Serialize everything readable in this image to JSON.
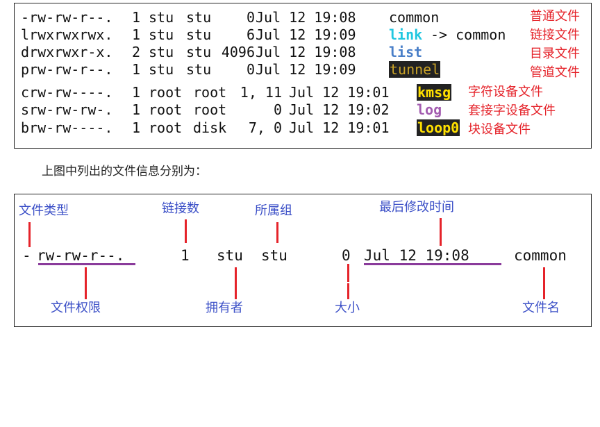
{
  "terminal": {
    "rows": [
      {
        "perm": "-rw-rw-r--.",
        "links": "1",
        "owner": "stu",
        "group": "stu",
        "size": "0",
        "date": "Jul 12 19:08",
        "name": "common",
        "target": "",
        "style": "plain",
        "note": "普通文件"
      },
      {
        "perm": "lrwxrwxrwx.",
        "links": "1",
        "owner": "stu",
        "group": "stu",
        "size": "6",
        "date": "Jul 12 19:09",
        "name": "link",
        "target": "-> common",
        "style": "cyan",
        "note": "链接文件"
      },
      {
        "perm": "drwxrwxr-x.",
        "links": "2",
        "owner": "stu",
        "group": "stu",
        "size": "4096",
        "date": "Jul 12 19:08",
        "name": "list",
        "target": "",
        "style": "blue",
        "note": "目录文件"
      },
      {
        "perm": "prw-rw-r--.",
        "links": "1",
        "owner": "stu",
        "group": "stu",
        "size": "0",
        "date": "Jul 12 19:09",
        "name": "tunnel",
        "target": "",
        "style": "tunnel",
        "note": "管道文件"
      },
      {
        "perm": "crw-rw----.",
        "links": "1",
        "owner": "root",
        "group": "root",
        "size": "1, 11",
        "date": "Jul 12 19:01",
        "name": "kmsg",
        "target": "",
        "style": "yel",
        "note": "字符设备文件"
      },
      {
        "perm": "srw-rw-rw-.",
        "links": "1",
        "owner": "root",
        "group": "root",
        "size": "0",
        "date": "Jul 12 19:02",
        "name": "log",
        "target": "",
        "style": "purple",
        "note": "套接字设备文件"
      },
      {
        "perm": "brw-rw----.",
        "links": "1",
        "owner": "root",
        "group": "disk",
        "size": "7, 0",
        "date": "Jul 12 19:01",
        "name": "loop0",
        "target": "",
        "style": "loop",
        "note": "块设备文件"
      }
    ]
  },
  "caption": "上图中列出的文件信息分别为：",
  "diagram": {
    "sample": {
      "type": "-",
      "perm": "rw-rw-r--.",
      "links": "1",
      "owner": "stu",
      "group": "stu",
      "size": "0",
      "date": "Jul 12 19:08",
      "name": "common"
    },
    "labels": {
      "file_type": "文件类型",
      "link_count": "链接数",
      "group": "所属组",
      "mtime": "最后修改时间",
      "permissions": "文件权限",
      "owner": "拥有者",
      "size": "大小",
      "filename": "文件名"
    },
    "colors": {
      "annotation_red": "#e5232a",
      "label_blue": "#3b4fc7",
      "underline_purple": "#8a3b9b"
    }
  }
}
